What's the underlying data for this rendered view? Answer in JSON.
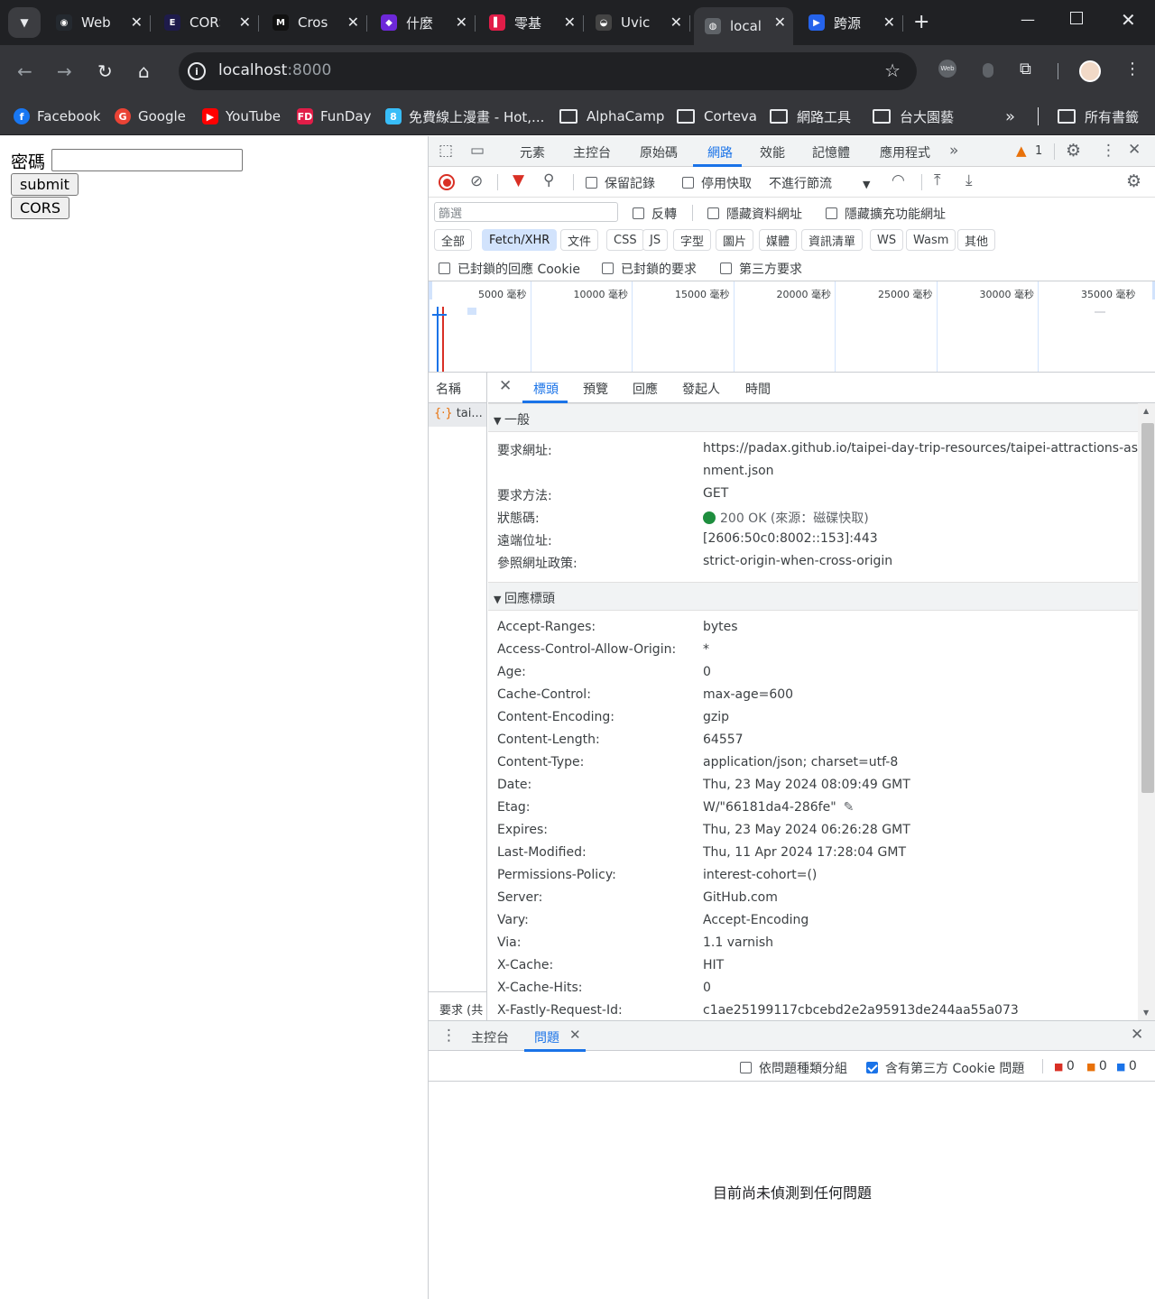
{
  "browser": {
    "tabs": [
      {
        "title": "Web",
        "fav": "github-icon",
        "color": "#24292f"
      },
      {
        "title": "CORS",
        "fav": "e-icon",
        "color": "#1e1b4b"
      },
      {
        "title": "Cros",
        "fav": "m-icon",
        "color": "#111"
      },
      {
        "title": "什麼",
        "fav": "cube-icon",
        "color": "#6d28d9"
      },
      {
        "title": "零基",
        "fav": "book-icon",
        "color": "#e11d48"
      },
      {
        "title": "Uvic",
        "fav": "unicorn-icon",
        "color": "#444"
      },
      {
        "title": "local",
        "fav": "globe-icon",
        "color": "#5f6368",
        "active": true
      },
      {
        "title": "跨源",
        "fav": "azure-icon",
        "color": "#2563eb"
      }
    ],
    "url_host": "localhost",
    "url_port": ":8000",
    "bookmarks": [
      {
        "label": "Facebook",
        "icon": "facebook-icon",
        "color": "#1877f2"
      },
      {
        "label": "Google",
        "icon": "google-icon",
        "color": "#ea4335"
      },
      {
        "label": "YouTube",
        "icon": "youtube-icon",
        "color": "#ff0000"
      },
      {
        "label": "FunDay",
        "icon": "funday-icon",
        "color": "#e11d48"
      },
      {
        "label": "免費線上漫畫 - Hot,...",
        "icon": "comic-icon",
        "color": "#38bdf8"
      },
      {
        "label": "AlphaCamp",
        "icon": "folder-icon"
      },
      {
        "label": "Corteva",
        "icon": "folder-icon"
      },
      {
        "label": "網路工具",
        "icon": "folder-icon"
      },
      {
        "label": "台大園藝",
        "icon": "folder-icon"
      }
    ],
    "all_bookmarks": "所有書籤"
  },
  "page": {
    "password_label": "密碼",
    "submit_label": "submit",
    "cors_label": "CORS"
  },
  "devtools": {
    "panels": [
      "元素",
      "主控台",
      "原始碼",
      "網路",
      "效能",
      "記憶體",
      "應用程式"
    ],
    "active_panel": "網路",
    "warning_count": "1",
    "preserve_log": "保留記錄",
    "disable_cache": "停用快取",
    "throttle": "不進行節流",
    "filter_placeholder": "篩選",
    "invert": "反轉",
    "hide_data_urls": "隱藏資料網址",
    "hide_ext_urls": "隱藏擴充功能網址",
    "type_chips": [
      "全部",
      "Fetch/XHR",
      "文件",
      "CSS",
      "JS",
      "字型",
      "圖片",
      "媒體",
      "資訊清單",
      "WS",
      "Wasm",
      "其他"
    ],
    "active_chip": "Fetch/XHR",
    "blocked_cookies": "已封鎖的回應 Cookie",
    "blocked_requests": "已封鎖的要求",
    "third_party": "第三方要求",
    "ticks": [
      "5000 毫秒",
      "10000 毫秒",
      "15000 毫秒",
      "20000 毫秒",
      "25000 毫秒",
      "30000 毫秒",
      "35000 毫秒"
    ],
    "names_header": "名稱",
    "request_name": "tai...",
    "names_footer": "要求 (共",
    "detail_tabs": [
      "標頭",
      "預覽",
      "回應",
      "發起人",
      "時間"
    ],
    "active_detail_tab": "標頭",
    "general_title": "一般",
    "general": [
      {
        "k": "要求網址:",
        "v": "https://padax.github.io/taipei-day-trip-resources/taipei-attractions-assig"
      },
      {
        "k": "",
        "v": "nment.json"
      },
      {
        "k": "要求方法:",
        "v": "GET"
      },
      {
        "k": "狀態碼:",
        "v": "200 OK (來源：磁碟快取)"
      },
      {
        "k": "遠端位址:",
        "v": "[2606:50c0:8002::153]:443"
      },
      {
        "k": "參照網址政策:",
        "v": "strict-origin-when-cross-origin"
      }
    ],
    "response_title": "回應標頭",
    "response_headers": [
      {
        "k": "Accept-Ranges:",
        "v": "bytes"
      },
      {
        "k": "Access-Control-Allow-Origin:",
        "v": "*"
      },
      {
        "k": "Age:",
        "v": "0"
      },
      {
        "k": "Cache-Control:",
        "v": "max-age=600"
      },
      {
        "k": "Content-Encoding:",
        "v": "gzip"
      },
      {
        "k": "Content-Length:",
        "v": "64557"
      },
      {
        "k": "Content-Type:",
        "v": "application/json; charset=utf-8"
      },
      {
        "k": "Date:",
        "v": "Thu, 23 May 2024 08:09:49 GMT"
      },
      {
        "k": "Etag:",
        "v": "W/\"66181da4-286fe\""
      },
      {
        "k": "Expires:",
        "v": "Thu, 23 May 2024 06:26:28 GMT"
      },
      {
        "k": "Last-Modified:",
        "v": "Thu, 11 Apr 2024 17:28:04 GMT"
      },
      {
        "k": "Permissions-Policy:",
        "v": "interest-cohort=()"
      },
      {
        "k": "Server:",
        "v": "GitHub.com"
      },
      {
        "k": "Vary:",
        "v": "Accept-Encoding"
      },
      {
        "k": "Via:",
        "v": "1.1 varnish"
      },
      {
        "k": "X-Cache:",
        "v": "HIT"
      },
      {
        "k": "X-Cache-Hits:",
        "v": "0"
      },
      {
        "k": "X-Fastly-Request-Id:",
        "v": "c1ae25199117cbcebd2e2a95913de244aa55a073"
      }
    ],
    "drawer_tabs": [
      "主控台",
      "問題"
    ],
    "active_drawer_tab": "問題",
    "group_by_kind": "依問題種類分組",
    "include_third_party": "含有第三方 Cookie 問題",
    "issue_counts": [
      "0",
      "0",
      "0"
    ],
    "no_issues": "目前尚未偵測到任何問題"
  }
}
